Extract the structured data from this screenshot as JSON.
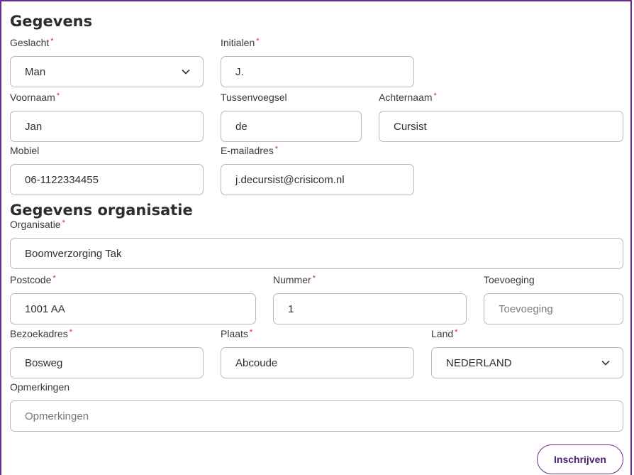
{
  "sections": {
    "personal_title": "Gegevens",
    "organisation_title": "Gegevens organisatie"
  },
  "required_marker": "*",
  "fields": {
    "geslacht": {
      "label": "Geslacht",
      "value": "Man"
    },
    "initialen": {
      "label": "Initialen",
      "value": "J."
    },
    "voornaam": {
      "label": "Voornaam",
      "value": "Jan"
    },
    "tussenvoegsel": {
      "label": "Tussenvoegsel",
      "value": "de"
    },
    "achternaam": {
      "label": "Achternaam",
      "value": "Cursist"
    },
    "mobiel": {
      "label": "Mobiel",
      "value": "06-1122334455"
    },
    "email": {
      "label": "E-mailadres",
      "value": "j.decursist@crisicom.nl"
    },
    "organisatie": {
      "label": "Organisatie",
      "value": "Boomverzorging Tak"
    },
    "postcode": {
      "label": "Postcode",
      "value": "1001 AA"
    },
    "nummer": {
      "label": "Nummer",
      "value": "1"
    },
    "toevoeging": {
      "label": "Toevoeging",
      "placeholder": "Toevoeging"
    },
    "bezoekadres": {
      "label": "Bezoekadres",
      "value": "Bosweg"
    },
    "plaats": {
      "label": "Plaats",
      "value": "Abcoude"
    },
    "land": {
      "label": "Land",
      "value": "NEDERLAND"
    },
    "opmerkingen": {
      "label": "Opmerkingen",
      "placeholder": "Opmerkingen"
    }
  },
  "buttons": {
    "submit_label": "Inschrijven"
  },
  "colors": {
    "accent": "#6a2c91",
    "required": "#d3243a",
    "border": "#b8b8b8"
  },
  "icons": {
    "select_arrow": "chevron-down-icon"
  }
}
